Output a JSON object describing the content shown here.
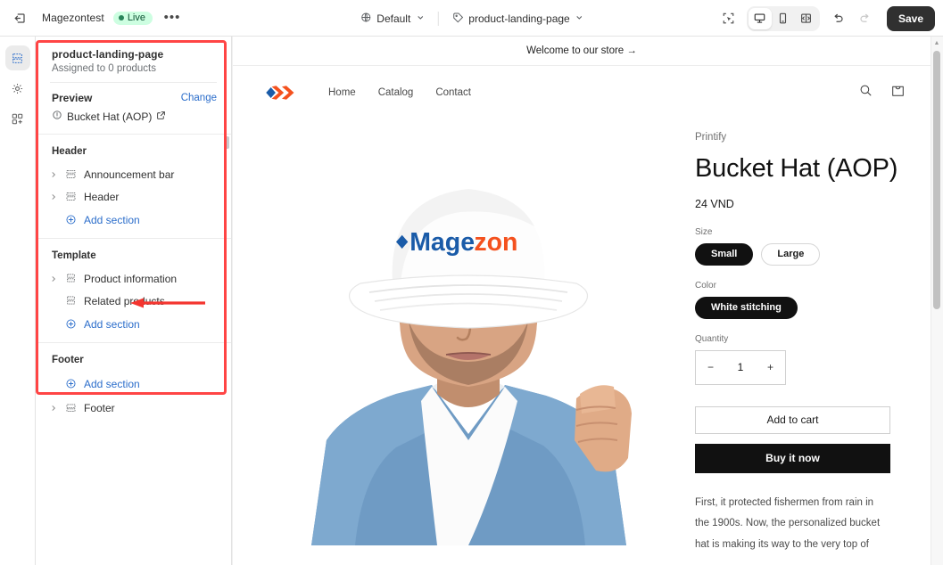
{
  "topbar": {
    "exit_icon": "exit-to-admin-icon",
    "store_name": "Magezontest",
    "status_badge": "Live",
    "more_label": "•••",
    "theme_chip": {
      "icon": "globe-icon",
      "label": "Default",
      "caret": "⌄"
    },
    "template_chip": {
      "icon": "tag-icon",
      "label": "product-landing-page",
      "caret": "⌄"
    },
    "actions": {
      "inspector_label": "Inspector",
      "desktop_label": "Desktop",
      "mobile_label": "Mobile",
      "fullscreen_label": "Full screen",
      "undo_label": "Undo",
      "redo_label": "Redo",
      "save_label": "Save"
    }
  },
  "rail": {
    "items": [
      {
        "name": "sections",
        "icon": "sections-icon",
        "active": true
      },
      {
        "name": "settings",
        "icon": "gear-icon",
        "active": false
      },
      {
        "name": "apps",
        "icon": "apps-icon",
        "active": false
      }
    ]
  },
  "sidebar": {
    "title": "product-landing-page",
    "subtitle": "Assigned to 0 products",
    "preview": {
      "label": "Preview",
      "change_label": "Change",
      "value": "Bucket Hat (AOP)",
      "info_icon": "info-circle-icon",
      "external_icon": "external-link-icon"
    },
    "groups": [
      {
        "title": "Header",
        "sections": [
          {
            "label": "Announcement bar",
            "icon": "section-icon",
            "expandable": true
          },
          {
            "label": "Header",
            "icon": "section-icon",
            "expandable": true
          }
        ],
        "add_label": "Add section",
        "add_position": "after"
      },
      {
        "title": "Template",
        "sections": [
          {
            "label": "Product information",
            "icon": "block-icon",
            "expandable": true
          },
          {
            "label": "Related products",
            "icon": "block-icon",
            "expandable": false
          }
        ],
        "add_label": "Add section",
        "add_position": "after"
      },
      {
        "title": "Footer",
        "sections": [
          {
            "label": "Footer",
            "icon": "footer-icon",
            "expandable": true
          }
        ],
        "add_label": "Add section",
        "add_position": "before"
      }
    ]
  },
  "preview": {
    "announcement": "Welcome to our store  →",
    "nav": [
      "Home",
      "Catalog",
      "Contact"
    ],
    "logo_name": "magezon-logo",
    "search_icon": "search-icon",
    "cart_icon": "cart-icon",
    "product": {
      "image_alt": "Man wearing white Magezon bucket hat with denim jacket",
      "vendor": "Printify",
      "title": "Bucket Hat (AOP)",
      "price": "24 VND",
      "size_label": "Size",
      "sizes": [
        {
          "label": "Small",
          "selected": true
        },
        {
          "label": "Large",
          "selected": false
        }
      ],
      "color_label": "Color",
      "colors": [
        {
          "label": "White stitching",
          "selected": true
        }
      ],
      "quantity_label": "Quantity",
      "quantity_value": "1",
      "minus_label": "−",
      "plus_label": "+",
      "add_to_cart_label": "Add to cart",
      "buy_now_label": "Buy it now",
      "description": "First, it protected fishermen from rain in the 1900s. Now, the personalized bucket hat is making its way to the very top of"
    }
  },
  "colors": {
    "accent_blue": "#2c6ecb",
    "annotation_red": "#ff4545",
    "live_badge_bg": "#cdfee1",
    "live_badge_text": "#0c5132",
    "logo_blue": "#1a5ba8",
    "logo_orange": "#f4511e",
    "save_dark": "#303030"
  }
}
